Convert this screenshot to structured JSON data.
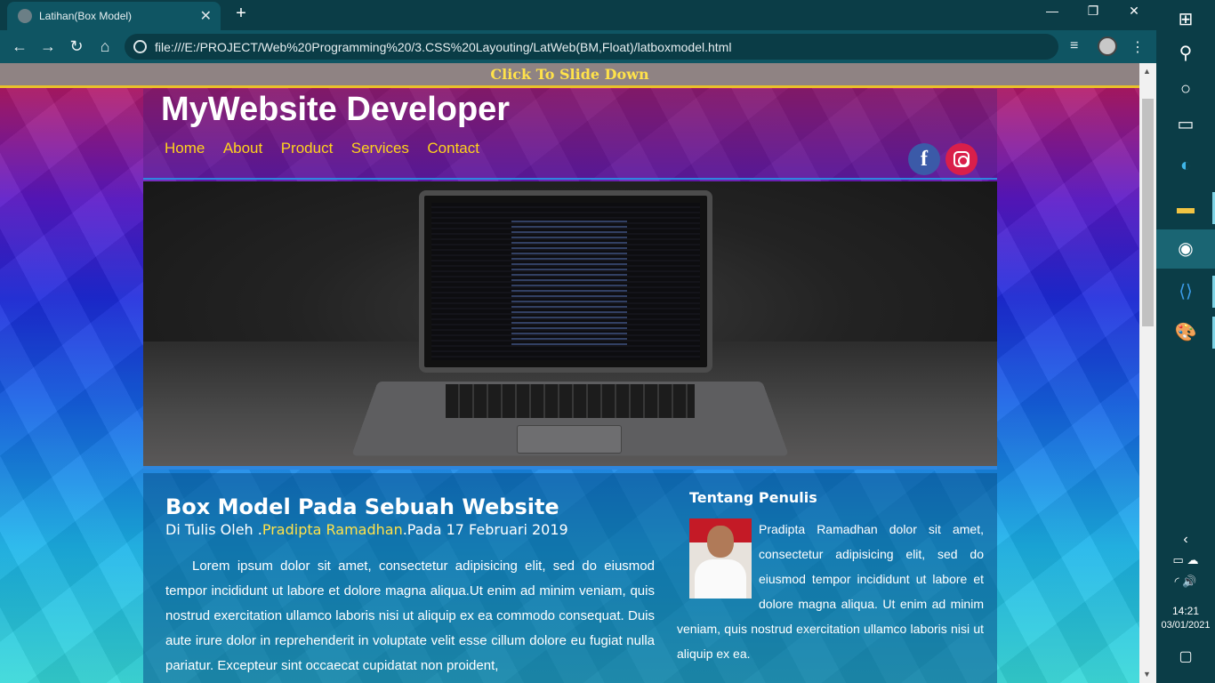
{
  "browser": {
    "tab_title": "Latihan(Box Model)",
    "url": "file:///E:/PROJECT/Web%20Programming%20/3.CSS%20Layouting/LatWeb(BM,Float)/latboxmodel.html"
  },
  "page": {
    "slide_label": "Click To Slide Down",
    "site_title": "MyWebsite Developer",
    "menu": [
      "Home",
      "About",
      "Product",
      "Services",
      "Contact"
    ],
    "social": {
      "facebook": "f"
    },
    "article": {
      "title": "Box Model Pada Sebuah Website",
      "byline_prefix": "Di Tulis Oleh .",
      "author": "Pradipta Ramadhan",
      "byline_suffix": ".Pada 17 Februari 2019",
      "body": "Lorem ipsum dolor sit amet, consectetur adipisicing elit, sed do eiusmod tempor incididunt ut labore et dolore magna aliqua.Ut enim ad minim veniam, quis nostrud exercitation ullamco laboris nisi ut aliquip ex ea commodo consequat. Duis aute irure dolor in reprehenderit in voluptate velit esse cillum dolore eu fugiat nulla pariatur. Excepteur sint occaecat cupidatat non proident,"
    },
    "aside": {
      "title": "Tentang Penulis",
      "body": "Pradipta Ramadhan dolor sit amet, consectetur adipisicing elit, sed do eiusmod tempor incididunt ut labore et dolore magna aliqua. Ut enim ad minim veniam, quis nostrud exercitation ullamco laboris nisi ut aliquip ex ea."
    }
  },
  "taskbar": {
    "time": "14:21",
    "date": "03/01/2021"
  },
  "colors": {
    "accent_yellow": "#ffd21c",
    "header_border": "#2e86de",
    "chrome_bg": "#0b3d47"
  }
}
